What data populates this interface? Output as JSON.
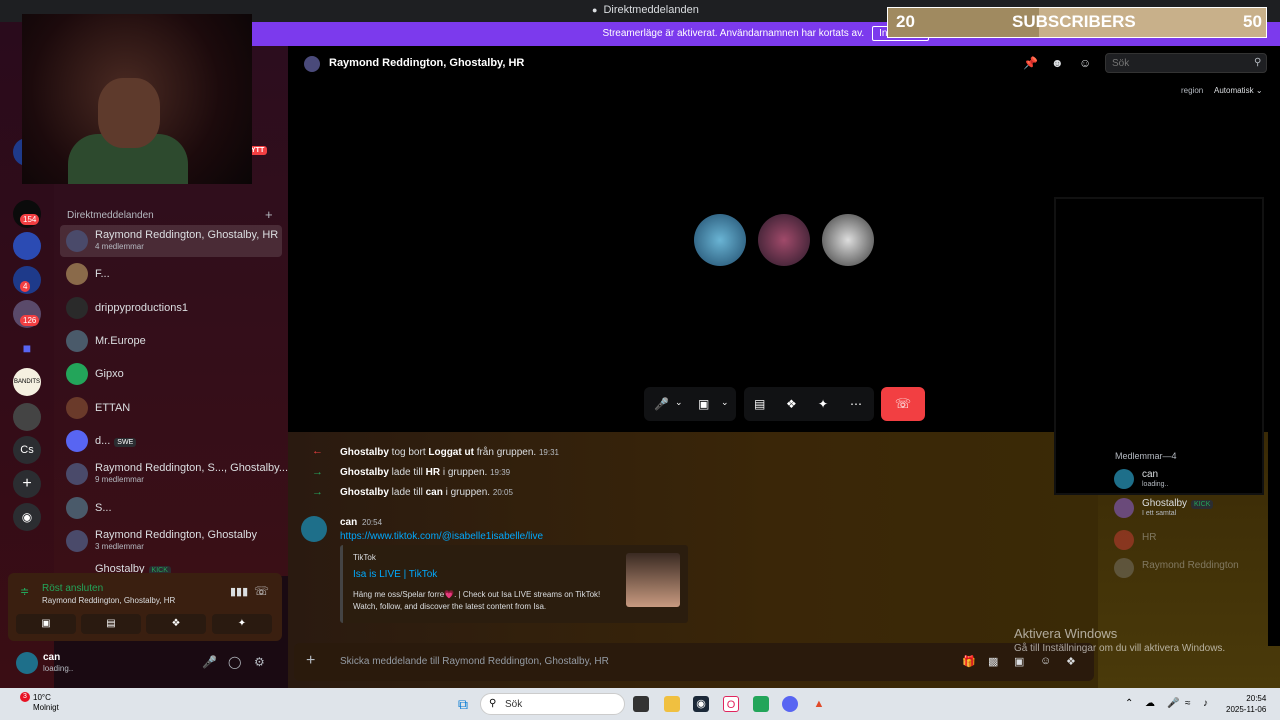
{
  "window": {
    "title": "Direktmeddelanden"
  },
  "streamer_banner": {
    "text": "Streamerläge är aktiverat. Användarnamnen har kortats av.",
    "button": "Inaktivera"
  },
  "servers": [
    {
      "label": "",
      "badge": ""
    },
    {
      "label": "",
      "badge": "154"
    },
    {
      "label": "",
      "badge": ""
    },
    {
      "label": "",
      "badge": "4"
    },
    {
      "label": "",
      "badge": "126"
    },
    {
      "label": "BANDITS",
      "badge": ""
    },
    {
      "label": "Cs",
      "badge": ""
    }
  ],
  "webcam_overlay_badge": "YTT",
  "sidebar": {
    "header": "Direktmeddelanden",
    "dms": [
      {
        "name": "Raymond Reddington, Ghostalby, HR",
        "sub": "4 medlemmar"
      },
      {
        "name": "F...",
        "sub": ""
      },
      {
        "name": "drippyproductions1",
        "sub": ""
      },
      {
        "name": "Mr.Europe",
        "sub": ""
      },
      {
        "name": "Gipxo",
        "sub": ""
      },
      {
        "name": "ETTAN",
        "sub": ""
      },
      {
        "name": "d...",
        "sub": "",
        "tag": "SWE"
      },
      {
        "name": "Raymond Reddington, S..., Ghostalby...",
        "sub": "9 medlemmar"
      },
      {
        "name": "S...",
        "sub": ""
      },
      {
        "name": "Raymond Reddington, Ghostalby",
        "sub": "3 medlemmar"
      },
      {
        "name": "Ghostalby",
        "sub": "",
        "tag": "KICK"
      }
    ]
  },
  "voice": {
    "status": "Röst ansluten",
    "channel": "Raymond Reddington, Ghostalby, HR"
  },
  "user": {
    "name": "can",
    "status": "loading.."
  },
  "call": {
    "header_name": "Raymond Reddington, Ghostalby, HR",
    "search_placeholder": "Sök",
    "region_label": "region",
    "region_value": "Automatisk"
  },
  "system_messages": [
    {
      "actor": "Ghostalby",
      "text1": " tog bort ",
      "target": "Loggat ut",
      "text2": " från gruppen.",
      "time": "19:31",
      "dir": "left"
    },
    {
      "actor": "Ghostalby",
      "text1": " lade till ",
      "target": "HR",
      "text2": " i gruppen.",
      "time": "19:39",
      "dir": "right"
    },
    {
      "actor": "Ghostalby",
      "text1": " lade till ",
      "target": "can",
      "text2": " i gruppen.",
      "time": "20:05",
      "dir": "right"
    }
  ],
  "message": {
    "author": "can",
    "time": "20:54",
    "link": "https://www.tiktok.com/@isabelle1isabelle/live",
    "embed": {
      "provider": "TikTok",
      "title": "Isa is LIVE | TikTok",
      "description": "Häng me oss/Spelar forre💗. | Check out Isa LIVE streams on TikTok! Watch, follow, and discover the latest content from Isa."
    }
  },
  "members": {
    "header": "Medlemmar—4",
    "list": [
      {
        "name": "can",
        "sub": "loading..",
        "tag": ""
      },
      {
        "name": "Ghostalby",
        "sub": "I ett samtal",
        "tag": "KICK"
      },
      {
        "name": "HR",
        "sub": "",
        "tag": ""
      },
      {
        "name": "Raymond Reddington",
        "sub": "",
        "tag": ""
      }
    ]
  },
  "input": {
    "placeholder": "Skicka meddelande till Raymond Reddington, Ghostalby, HR"
  },
  "windows_watermark": {
    "line1": "Aktivera Windows",
    "line2": "Gå till Inställningar om du vill aktivera Windows."
  },
  "subscriber_goal": {
    "current": "20",
    "label": "SUBSCRIBERS",
    "goal": "50",
    "progress": 0.4
  },
  "taskbar": {
    "weather_badge": "3",
    "weather_temp": "10°C",
    "weather_desc": "Molnigt",
    "search_placeholder": "Sök",
    "time": "20:54",
    "date": "2025-11-06"
  },
  "colors": {
    "accent": "#7c3aed",
    "hangup": "#f23f42",
    "online": "#23a55a",
    "link": "#00a8fc"
  }
}
